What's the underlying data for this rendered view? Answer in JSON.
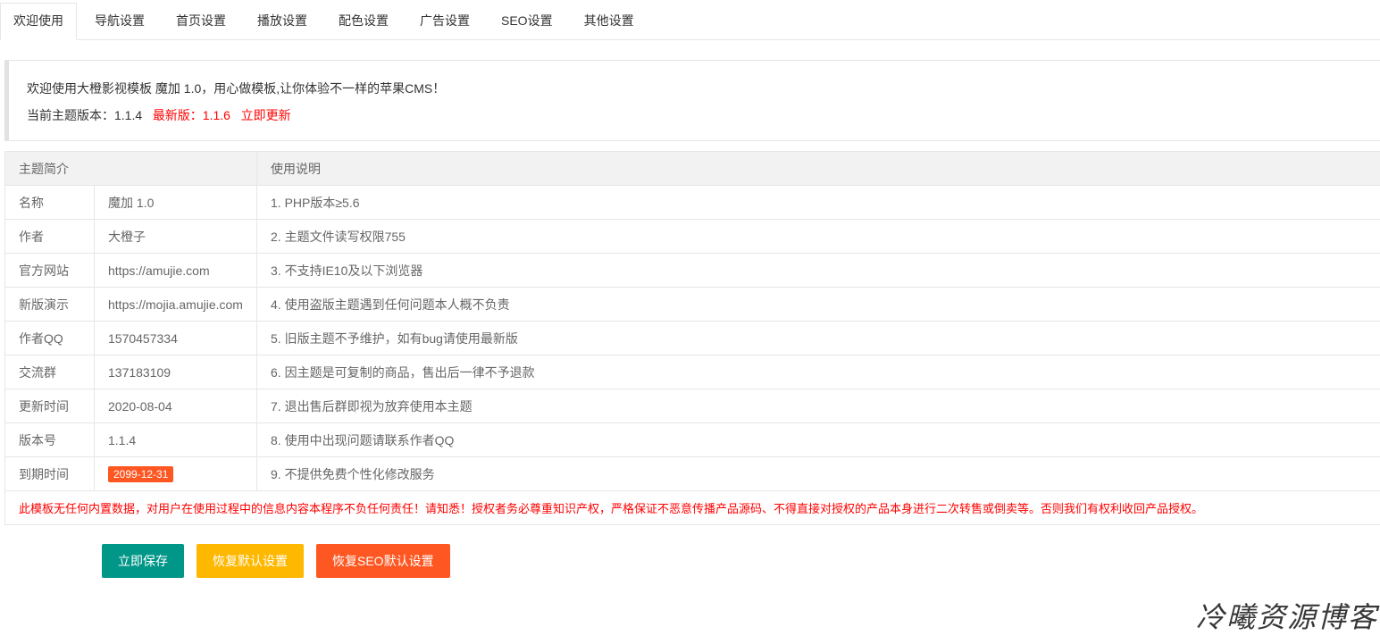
{
  "tabs": [
    {
      "label": "欢迎使用",
      "active": true
    },
    {
      "label": "导航设置"
    },
    {
      "label": "首页设置"
    },
    {
      "label": "播放设置"
    },
    {
      "label": "配色设置"
    },
    {
      "label": "广告设置"
    },
    {
      "label": "SEO设置"
    },
    {
      "label": "其他设置"
    }
  ],
  "notice": {
    "welcome": "欢迎使用大橙影视模板 魔加 1.0，用心做模板,让你体验不一样的苹果CMS！",
    "current_version_label": "当前主题版本：1.1.4",
    "latest_version_label": "最新版：1.1.6",
    "update_link": "立即更新"
  },
  "table": {
    "header_left": "主题简介",
    "header_right": "使用说明",
    "rows": [
      {
        "label": "名称",
        "value": "魔加 1.0",
        "note": "1. PHP版本≥5.6"
      },
      {
        "label": "作者",
        "value": "大橙子",
        "note": "2. 主题文件读写权限755"
      },
      {
        "label": "官方网站",
        "value": "https://amujie.com",
        "note": "3. 不支持IE10及以下浏览器"
      },
      {
        "label": "新版演示",
        "value": "https://mojia.amujie.com",
        "note": "4. 使用盗版主题遇到任何问题本人概不负责"
      },
      {
        "label": "作者QQ",
        "value": "1570457334",
        "note": "5. 旧版主题不予维护，如有bug请使用最新版"
      },
      {
        "label": "交流群",
        "value": "137183109",
        "note": "6. 因主题是可复制的商品，售出后一律不予退款"
      },
      {
        "label": "更新时间",
        "value": "2020-08-04",
        "note": "7. 退出售后群即视为放弃使用本主题"
      },
      {
        "label": "版本号",
        "value": "1.1.4",
        "note": "8. 使用中出现问题请联系作者QQ"
      },
      {
        "label": "到期时间",
        "value": "2099-12-31",
        "note": "9. 不提供免费个性化修改服务"
      }
    ],
    "warning": "此模板无任何内置数据，对用户在使用过程中的信息内容本程序不负任何责任！请知悉！授权者务必尊重知识产权，严格保证不恶意传播产品源码、不得直接对授权的产品本身进行二次转售或倒卖等。否则我们有权利收回产品授权。"
  },
  "buttons": {
    "save": "立即保存",
    "reset": "恢复默认设置",
    "reset_seo": "恢复SEO默认设置"
  },
  "watermark": "冷曦资源博客",
  "colors": {
    "save": "#009688",
    "reset": "#ffb800",
    "seo": "#ff5722",
    "warning": "#ff0000"
  }
}
